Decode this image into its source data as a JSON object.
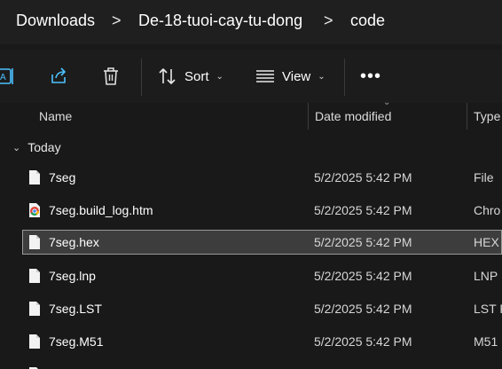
{
  "breadcrumb": {
    "items": [
      "Downloads",
      "De-18-tuoi-cay-tu-dong",
      "code"
    ],
    "separator": ">"
  },
  "toolbar": {
    "sort_label": "Sort",
    "view_label": "View",
    "more_label": "•••"
  },
  "columns": {
    "name": "Name",
    "date_modified": "Date modified",
    "type": "Type"
  },
  "group": {
    "label": "Today"
  },
  "files": [
    {
      "name": "7seg",
      "date": "5/2/2025 5:42 PM",
      "type": "File",
      "icon": "file-icon"
    },
    {
      "name": "7seg.build_log.htm",
      "date": "5/2/2025 5:42 PM",
      "type": "Chro",
      "icon": "chrome-icon"
    },
    {
      "name": "7seg.hex",
      "date": "5/2/2025 5:42 PM",
      "type": "HEX",
      "icon": "file-icon",
      "selected": true
    },
    {
      "name": "7seg.lnp",
      "date": "5/2/2025 5:42 PM",
      "type": "LNP",
      "icon": "file-icon"
    },
    {
      "name": "7seg.LST",
      "date": "5/2/2025 5:42 PM",
      "type": "LST F",
      "icon": "file-icon"
    },
    {
      "name": "7seg.M51",
      "date": "5/2/2025 5:42 PM",
      "type": "M51",
      "icon": "file-icon"
    }
  ],
  "colors": {
    "accent_blue": "#4cc2ff",
    "background": "#191919",
    "selected_row": "#3d3d3d"
  }
}
